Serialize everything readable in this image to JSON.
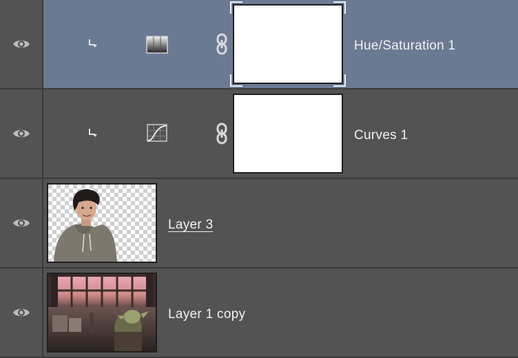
{
  "layers": [
    {
      "name": "Hue/Saturation 1",
      "type": "adjustment",
      "adjustment": "hue-saturation",
      "selected": true,
      "clipped": true,
      "visible": true,
      "linked_mask": true
    },
    {
      "name": "Curves 1",
      "type": "adjustment",
      "adjustment": "curves",
      "selected": false,
      "clipped": true,
      "visible": true,
      "linked_mask": true
    },
    {
      "name": "Layer 3",
      "type": "pixel",
      "selected": false,
      "visible": true,
      "name_underlined": true,
      "thumbnail": "person-cutout"
    },
    {
      "name": "Layer 1 copy",
      "type": "pixel",
      "selected": false,
      "visible": true,
      "thumbnail": "hangar-scene"
    }
  ],
  "colors": {
    "panel_bg": "#535353",
    "selected_bg": "#6a7a93",
    "separator": "#3a3a3a",
    "text": "#f2f2f2"
  },
  "icons": {
    "visibility": "eye-icon",
    "clip": "clip-arrow-icon",
    "hue_saturation": "hue-saturation-icon",
    "curves": "curves-icon",
    "link": "chain-link-icon"
  }
}
